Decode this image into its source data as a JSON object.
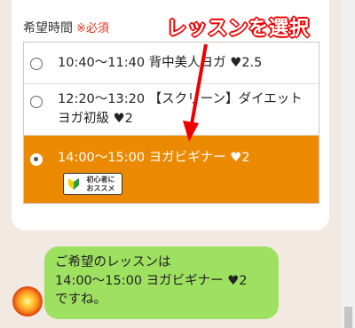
{
  "form": {
    "label": "希望時間",
    "required": "※必須"
  },
  "options": [
    {
      "text": "10:40〜11:40 背中美人ヨガ ♥2.5",
      "selected": false
    },
    {
      "text": "12:20〜13:20 【スクリーン】ダイエットヨガ初級 ♥2",
      "selected": false
    },
    {
      "text": "14:00〜15:00 ヨガビギナー ♥2",
      "selected": true
    }
  ],
  "badge": {
    "line1": "初心者に",
    "line2": "おススメ",
    "icon": "beginner-leaf-icon"
  },
  "annotation": "レッスンを選択",
  "chat": {
    "line1": "ご希望のレッスンは",
    "line2": "14:00〜15:00 ヨガビギナー ♥2",
    "line3": "ですね。"
  },
  "colors": {
    "selected": "#eb8a00",
    "bubble": "#9ee060",
    "required": "#e8321e",
    "annotation": "#ee0000"
  }
}
